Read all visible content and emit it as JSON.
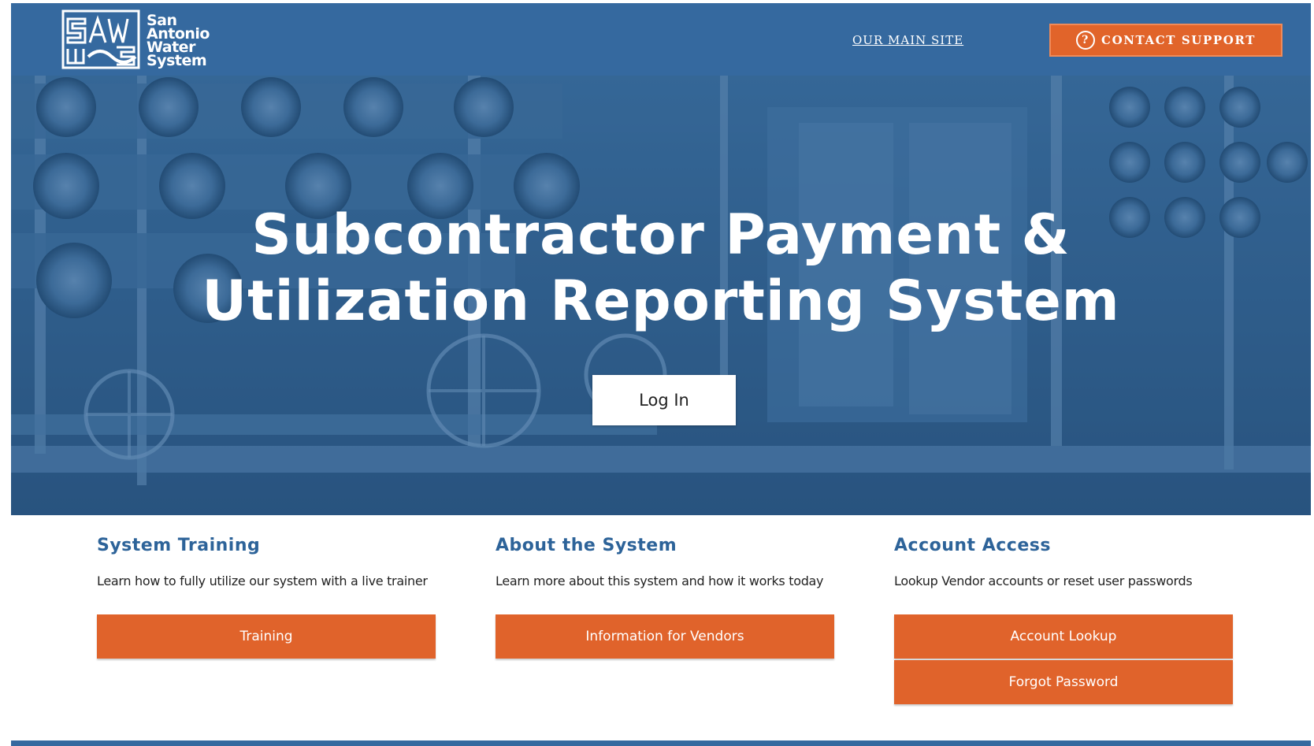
{
  "header": {
    "logo_lines": [
      "San",
      "Antonio",
      "Water",
      "System"
    ],
    "main_site_link": "OUR MAIN SITE",
    "contact_support_label": "CONTACT SUPPORT",
    "contact_icon": "question-circle-icon",
    "help_glyph": "?",
    "background_color": "#35699f",
    "accent_color": "#e1642a"
  },
  "hero": {
    "title_line1": "Subcontractor Payment &",
    "title_line2": "Utilization Reporting System",
    "login_label": "Log In",
    "overlay_color": "#2f5f8e"
  },
  "cards": [
    {
      "title": "System Training",
      "description": "Learn how to fully utilize our system with a live trainer",
      "buttons": [
        "Training"
      ]
    },
    {
      "title": "About the System",
      "description": "Learn more about this system and how it works today",
      "buttons": [
        "Information for Vendors"
      ]
    },
    {
      "title": "Account Access",
      "description": "Lookup Vendor accounts or reset user passwords",
      "buttons": [
        "Account Lookup",
        "Forgot Password"
      ]
    }
  ],
  "colors": {
    "card_title": "#2d6399",
    "button": "#e0632b"
  }
}
